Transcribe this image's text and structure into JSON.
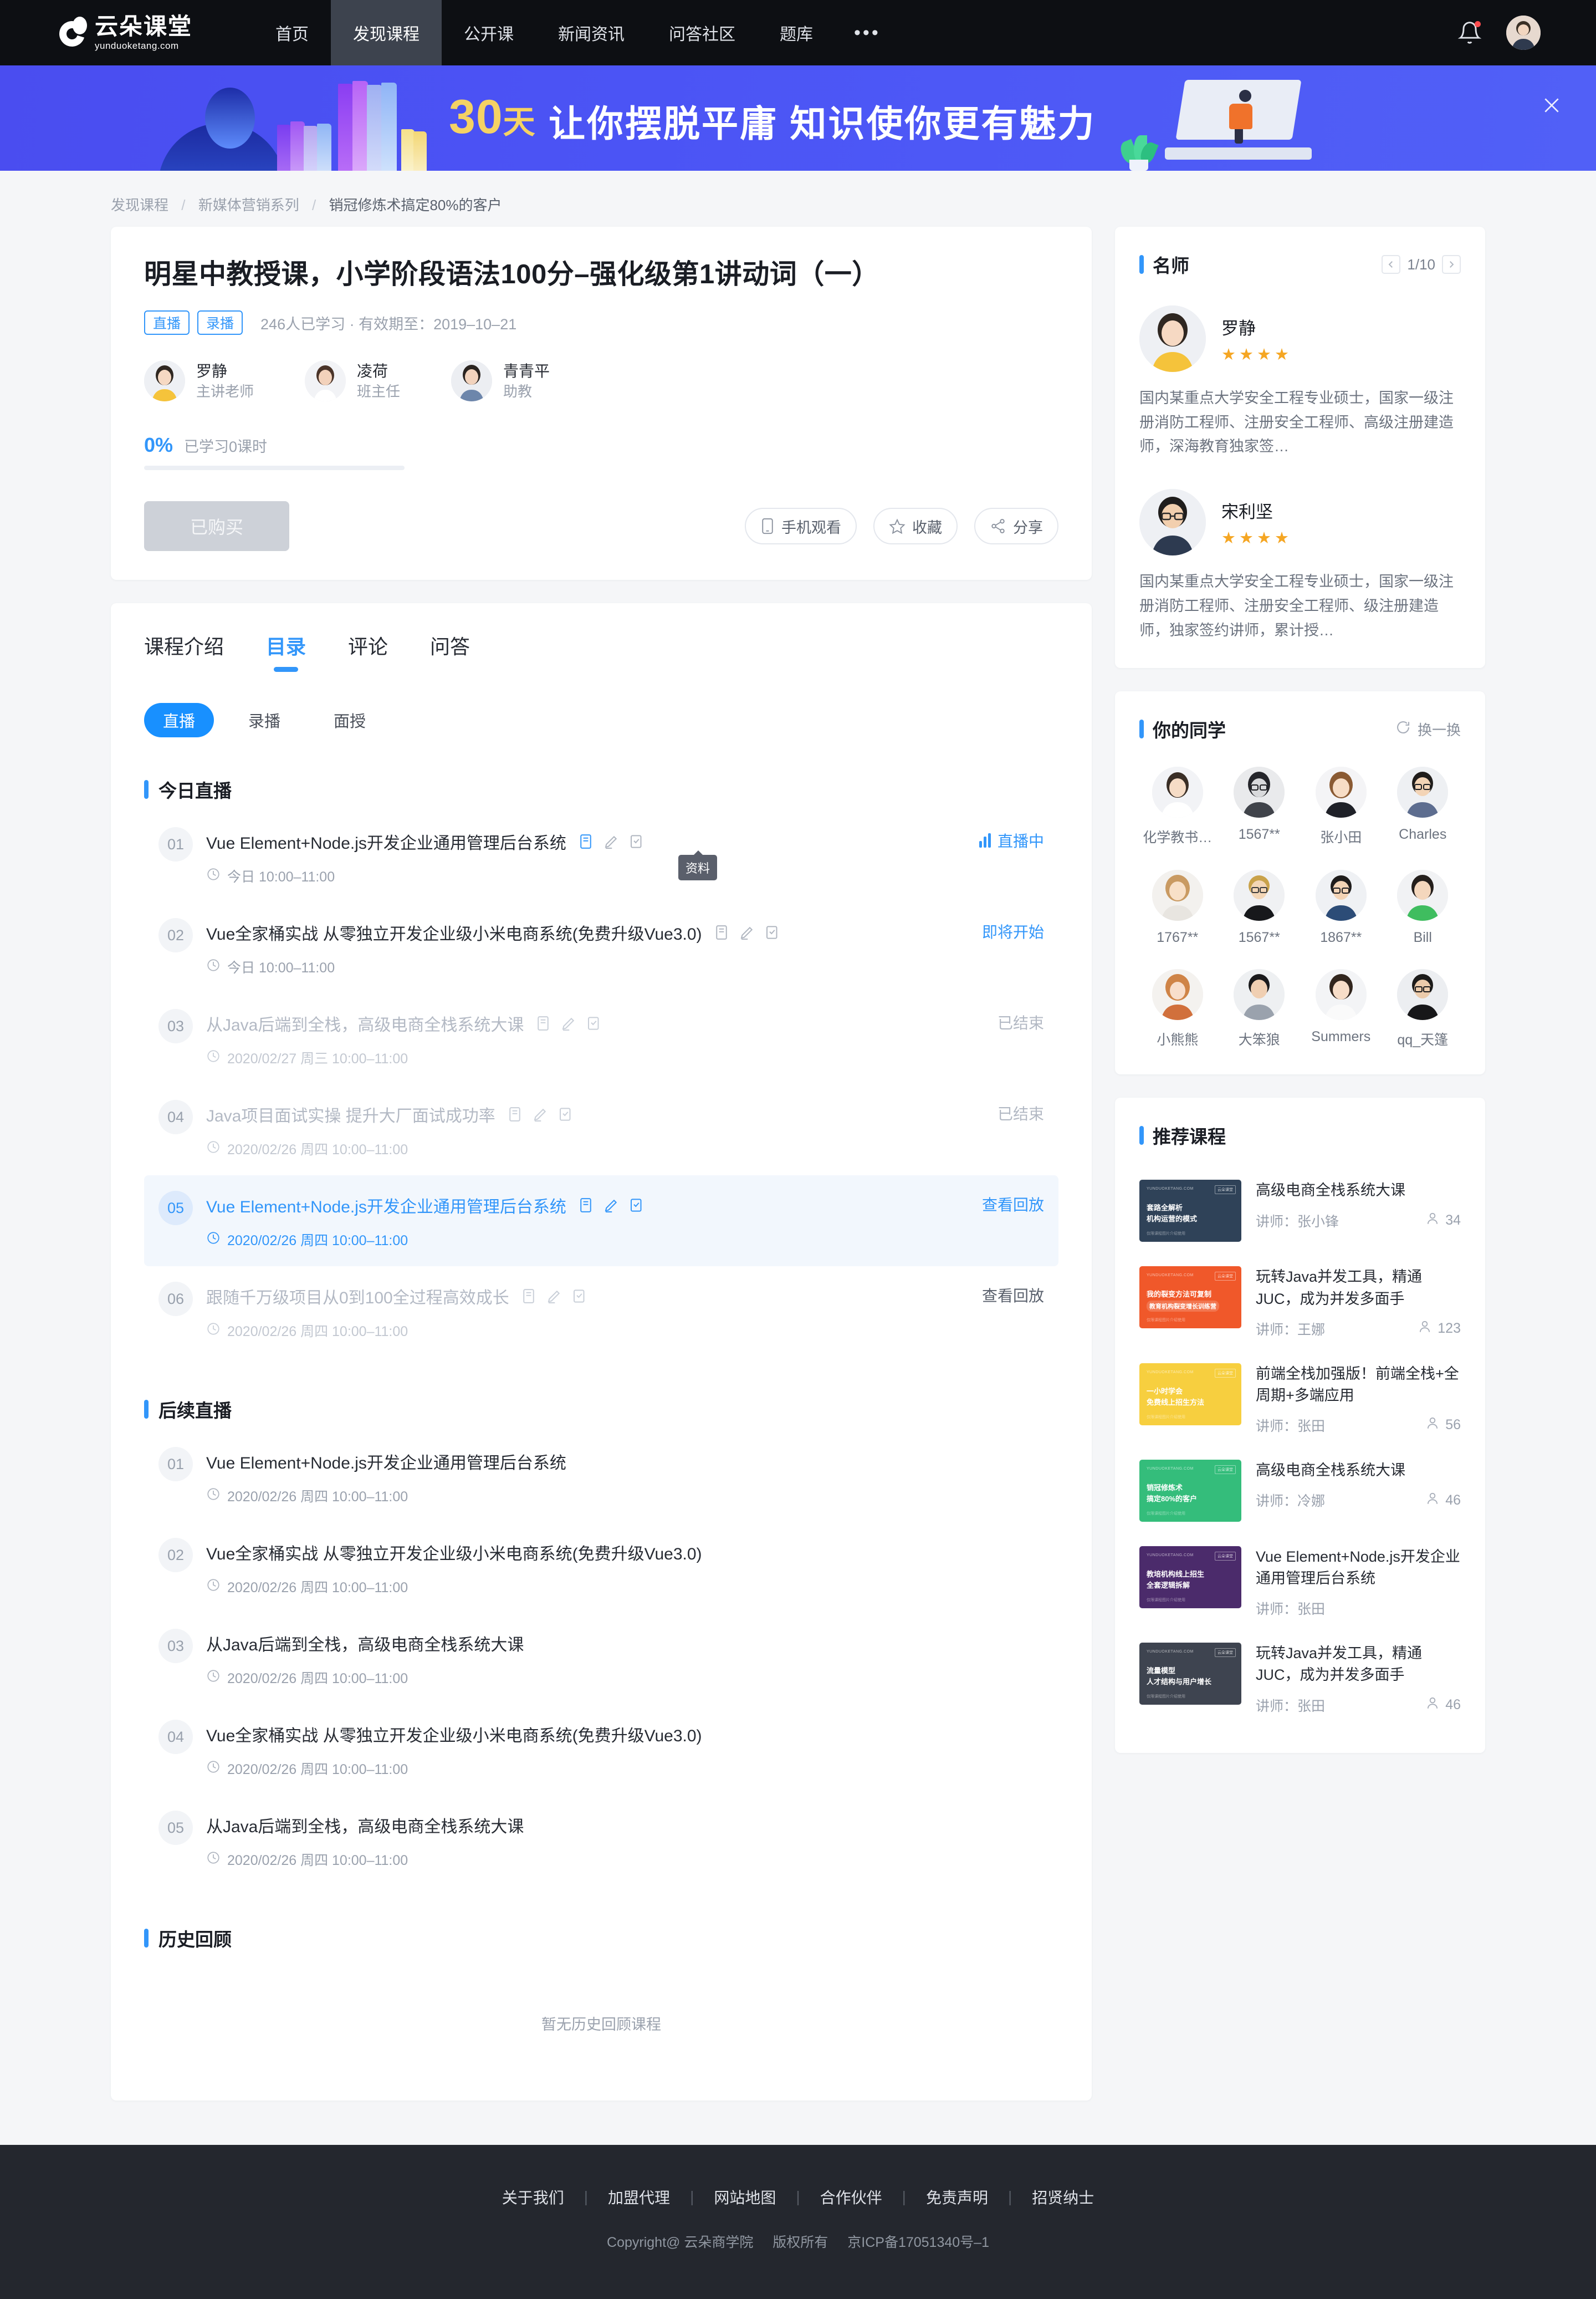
{
  "nav": {
    "logo_cn": "云朵课堂",
    "logo_en": "yunduoketang.com",
    "items": [
      {
        "label": "首页",
        "active": false
      },
      {
        "label": "发现课程",
        "active": true
      },
      {
        "label": "公开课",
        "active": false
      },
      {
        "label": "新闻资讯",
        "active": false
      },
      {
        "label": "问答社区",
        "active": false
      },
      {
        "label": "题库",
        "active": false
      }
    ],
    "more": "•••"
  },
  "banner": {
    "number": "30",
    "number_unit": "天",
    "text": "让你摆脱平庸  知识使你更有魅力"
  },
  "breadcrumb": {
    "items": [
      "发现课程",
      "新媒体营销系列",
      "销冠修炼术搞定80%的客户"
    ]
  },
  "course": {
    "title": "明星中教授课，小学阶段语法100分–强化级第1讲动词（一）",
    "tags": [
      "直播",
      "录播"
    ],
    "meta": "246人已学习 · 有效期至：2019–10–21",
    "teachers": [
      {
        "name": "罗静",
        "role": "主讲老师"
      },
      {
        "name": "凌荷",
        "role": "班主任"
      },
      {
        "name": "青青平",
        "role": "助教"
      }
    ],
    "progress_pct": "0%",
    "progress_value": 0,
    "progress_label": "已学习0课时",
    "buy_label": "已购买",
    "actions": [
      {
        "label": "手机观看",
        "icon": "mobile-icon"
      },
      {
        "label": "收藏",
        "icon": "star-icon"
      },
      {
        "label": "分享",
        "icon": "share-icon"
      }
    ]
  },
  "tabs": [
    {
      "label": "课程介绍",
      "active": false
    },
    {
      "label": "目录",
      "active": true
    },
    {
      "label": "评论",
      "active": false
    },
    {
      "label": "问答",
      "active": false
    }
  ],
  "subtabs": [
    {
      "label": "直播",
      "active": true
    },
    {
      "label": "录播",
      "active": false
    },
    {
      "label": "面授",
      "active": false
    }
  ],
  "tooltip": "资料",
  "sections": [
    {
      "title": "今日直播",
      "lessons": [
        {
          "num": "01",
          "title": "Vue Element+Node.js开发企业通用管理后台系统",
          "time": "今日 10:00–11:00",
          "status": "直播中",
          "status_type": "live",
          "icons": true,
          "state": "active"
        },
        {
          "num": "02",
          "title": "Vue全家桶实战 从零独立开发企业级小米电商系统(免费升级Vue3.0)",
          "time": "今日 10:00–11:00",
          "status": "即将开始",
          "status_type": "soon",
          "icons": true,
          "state": "active"
        },
        {
          "num": "03",
          "title": "从Java后端到全栈，高级电商全栈系统大课",
          "time": "2020/02/27 周三 10:00–11:00",
          "status": "已结束",
          "status_type": "ended",
          "icons": true,
          "state": "ended"
        },
        {
          "num": "04",
          "title": "Java项目面试实操 提升大厂面试成功率",
          "time": "2020/02/26 周四 10:00–11:00",
          "status": "已结束",
          "status_type": "ended",
          "icons": true,
          "state": "ended"
        },
        {
          "num": "05",
          "title": "Vue Element+Node.js开发企业通用管理后台系统",
          "time": "2020/02/26 周四 10:00–11:00",
          "status": "查看回放",
          "status_type": "replay",
          "icons": true,
          "state": "highlight"
        },
        {
          "num": "06",
          "title": "跟随千万级项目从0到100全过程高效成长",
          "time": "2020/02/26 周四 10:00–11:00",
          "status": "查看回放",
          "status_type": "replay",
          "icons": true,
          "state": "ended"
        }
      ]
    },
    {
      "title": "后续直播",
      "lessons": [
        {
          "num": "01",
          "title": "Vue Element+Node.js开发企业通用管理后台系统",
          "time": "2020/02/26 周四 10:00–11:00",
          "status": "",
          "status_type": "none",
          "icons": false,
          "state": "plain"
        },
        {
          "num": "02",
          "title": "Vue全家桶实战 从零独立开发企业级小米电商系统(免费升级Vue3.0)",
          "time": "2020/02/26 周四 10:00–11:00",
          "status": "",
          "status_type": "none",
          "icons": false,
          "state": "plain"
        },
        {
          "num": "03",
          "title": "从Java后端到全栈，高级电商全栈系统大课",
          "time": "2020/02/26 周四 10:00–11:00",
          "status": "",
          "status_type": "none",
          "icons": false,
          "state": "plain"
        },
        {
          "num": "04",
          "title": "Vue全家桶实战 从零独立开发企业级小米电商系统(免费升级Vue3.0)",
          "time": "2020/02/26 周四 10:00–11:00",
          "status": "",
          "status_type": "none",
          "icons": false,
          "state": "plain"
        },
        {
          "num": "05",
          "title": "从Java后端到全栈，高级电商全栈系统大课",
          "time": "2020/02/26 周四 10:00–11:00",
          "status": "",
          "status_type": "none",
          "icons": false,
          "state": "plain"
        }
      ]
    },
    {
      "title": "历史回顾",
      "lessons": [],
      "empty": "暂无历史回顾课程"
    }
  ],
  "side_teachers": {
    "title": "名师",
    "page": "1/10",
    "list": [
      {
        "name": "罗静",
        "stars": 4,
        "desc": "国内某重点大学安全工程专业硕士，国家一级注册消防工程师、注册安全工程师、高级注册建造师，深海教育独家签…"
      },
      {
        "name": "宋利坚",
        "stars": 4,
        "desc": "国内某重点大学安全工程专业硕士，国家一级注册消防工程师、注册安全工程师、级注册建造师，独家签约讲师，累计授…"
      }
    ]
  },
  "classmates": {
    "title": "你的同学",
    "refresh_label": "换一换",
    "list": [
      {
        "name": "化学教书…"
      },
      {
        "name": "1567**"
      },
      {
        "name": "张小田"
      },
      {
        "name": "Charles"
      },
      {
        "name": "1767**"
      },
      {
        "name": "1567**"
      },
      {
        "name": "1867**"
      },
      {
        "name": "Bill"
      },
      {
        "name": "小熊熊"
      },
      {
        "name": "大笨狼"
      },
      {
        "name": "Summers"
      },
      {
        "name": "qq_天篷"
      }
    ]
  },
  "recommend": {
    "title": "推荐课程",
    "items": [
      {
        "title": "高级电商全栈系统大课",
        "teacher": "讲师：张小锋",
        "count": "34",
        "thumb_color": "#2f4258",
        "thumb_line1": "套路全解析",
        "thumb_line2": "机构运营的模式",
        "thumb_brand": "YUNDUOKETANG.COM",
        "thumb_badge": "云朵课堂",
        "thumb_foot": "仅限课程图片介绍使用"
      },
      {
        "title": "玩转Java并发工具，精通JUC，成为并发多面手",
        "teacher": "讲师：王娜",
        "count": "123",
        "thumb_color": "#f0582a",
        "thumb_line1": "我的裂变方法可复制",
        "thumb_line2": "教育机构裂变增长训练营",
        "thumb_brand": "YUNDUOKETANG.COM",
        "thumb_badge": "云朵课堂",
        "thumb_foot": "仅限课程图片介绍使用"
      },
      {
        "title": "前端全栈加强版！前端全栈+全周期+多端应用",
        "teacher": "讲师：张田",
        "count": "56",
        "thumb_color": "#f7cf3f",
        "thumb_line1": "一小时学会",
        "thumb_line2": "免费线上招生方法",
        "thumb_brand": "YUNDUOKETANG.COM",
        "thumb_badge": "云朵课堂",
        "thumb_foot": "仅限课程图片介绍使用"
      },
      {
        "title": "高级电商全栈系统大课",
        "teacher": "讲师：冷娜",
        "count": "46",
        "thumb_color": "#34bd7b",
        "thumb_line1": "销冠修炼术",
        "thumb_line2": "搞定80%的客户",
        "thumb_brand": "YUNDUOKETANG.COM",
        "thumb_badge": "云朵课堂",
        "thumb_foot": "仅限课程图片介绍使用"
      },
      {
        "title": "Vue Element+Node.js开发企业通用管理后台系统",
        "teacher": "讲师：张田",
        "count": "",
        "thumb_color": "#4b2b6b",
        "thumb_line1": "教培机构线上招生",
        "thumb_line2": "全套逻辑拆解",
        "thumb_brand": "YUNDUOKETANG.COM",
        "thumb_badge": "云朵课堂",
        "thumb_foot": "仅限课程图片介绍使用"
      },
      {
        "title": "玩转Java并发工具，精通JUC，成为并发多面手",
        "teacher": "讲师：张田",
        "count": "46",
        "thumb_color": "#3e4450",
        "thumb_line1": "流量模型",
        "thumb_line2": "人才结构与用户增长",
        "thumb_brand": "YUNDUOKETANG.COM",
        "thumb_badge": "云朵课堂",
        "thumb_foot": "仅限课程图片介绍使用"
      }
    ]
  },
  "footer": {
    "links": [
      "关于我们",
      "加盟代理",
      "网站地图",
      "合作伙伴",
      "免责声明",
      "招贤纳士"
    ],
    "copyright": "Copyright@ 云朵商学院",
    "rights": "版权所有",
    "icp": "京ICP备17051340号–1"
  },
  "colors": {
    "accent": "#3296fa",
    "nav_bg": "#0d0f13",
    "banner_from": "#4a4df0",
    "footer_bg": "#24272e",
    "star": "#f5a623"
  }
}
